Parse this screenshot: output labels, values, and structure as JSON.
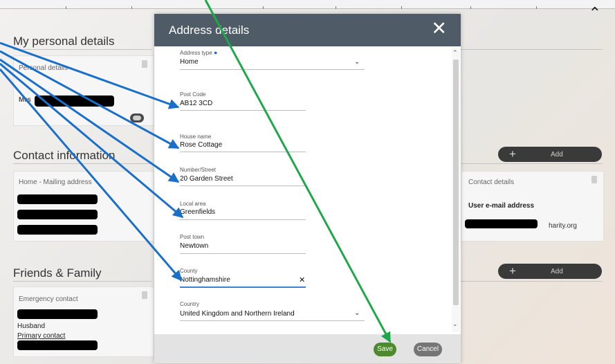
{
  "personal": {
    "section_title": "My personal details",
    "card_label": "Personal details",
    "title_prefix": "Mrs"
  },
  "contact": {
    "section_title": "Contact information",
    "home_label": "Home - Mailing address",
    "details_label": "Contact details",
    "email_label": "User e-mail address",
    "email_visible": "harity.org",
    "add_label": "Add"
  },
  "family": {
    "section_title": "Friends & Family",
    "card_label": "Emergency contact",
    "relationship": "Husband",
    "primary": "Primary contact",
    "add_label": "Add"
  },
  "modal": {
    "title": "Address details",
    "close": "✕",
    "fields": {
      "address_type": {
        "label": "Address type",
        "value": "Home"
      },
      "post_code": {
        "label": "Post Code",
        "value": "AB12 3CD"
      },
      "house_name": {
        "label": "House name",
        "value": "Rose Cottage"
      },
      "number_street": {
        "label": "Number/Street",
        "value": "20 Garden Street"
      },
      "local_area": {
        "label": "Local area",
        "value": "Greenfields"
      },
      "post_town": {
        "label": "Post town",
        "value": "Newtown"
      },
      "county": {
        "label": "County",
        "value": "Nottinghamshire"
      },
      "country": {
        "label": "Country",
        "value": "United Kingdom and Northern Ireland"
      }
    },
    "save_label": "Save",
    "cancel_label": "Cancel"
  },
  "colors": {
    "modal_header": "#4f5b66",
    "save": "#4c8a2b",
    "cancel": "#757575",
    "arrow_blue": "#1a6fc9",
    "arrow_green": "#1fa84a"
  },
  "icons": [
    "collapse-chevron-icon",
    "document-icon",
    "toggle-icon",
    "plus-icon",
    "close-icon",
    "chevron-down-icon",
    "clear-x-icon",
    "scroll-up-icon",
    "scroll-down-icon"
  ]
}
